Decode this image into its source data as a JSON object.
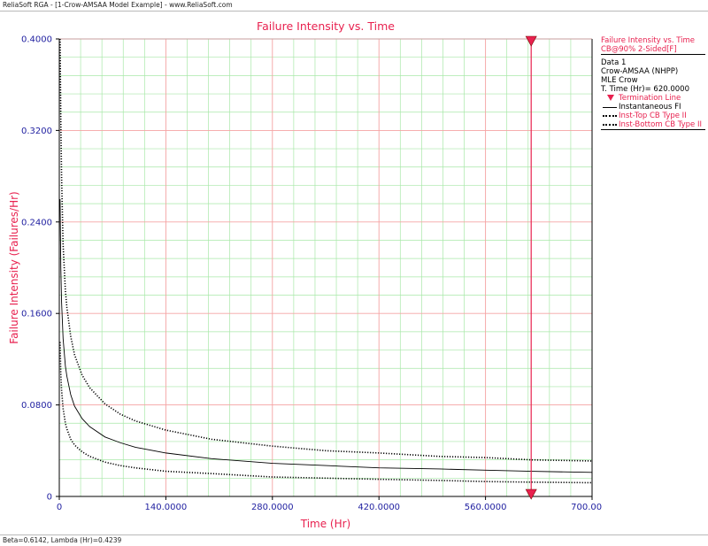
{
  "window": {
    "title": "ReliaSoft RGA - [1-Crow-AMSAA Model Example] - www.ReliaSoft.com"
  },
  "status_bar": {
    "text": "Beta=0.6142, Lambda (Hr)=0.4239"
  },
  "legend": {
    "title": "Failure Intensity vs. Time",
    "subtitle": "CB@90% 2-Sided[F]",
    "info_lines": [
      "Data 1",
      "Crow-AMSAA (NHPP)",
      "MLE Crow",
      "T. Time (Hr)= 620.0000"
    ],
    "entries": [
      {
        "label": "Termination Line",
        "style": "triangle"
      },
      {
        "label": "Instantaneous FI",
        "style": "solid"
      },
      {
        "label": "Inst-Top CB Type II",
        "style": "dotted"
      },
      {
        "label": "Inst-Bottom CB Type II",
        "style": "dotted"
      }
    ]
  },
  "colors": {
    "accent": "#e8214f",
    "axis_text": "#1f1fa0",
    "major_grid": "#f5a3a3",
    "minor_grid": "#a8e8a8",
    "curve": "#000000"
  },
  "chart_data": {
    "type": "line",
    "title": "Failure Intensity vs. Time",
    "xlabel": "Time (Hr)",
    "ylabel": "Failure Intensity (Failures/Hr)",
    "xlim": [
      0,
      700
    ],
    "ylim": [
      0,
      0.4
    ],
    "xticks": [
      0,
      140,
      280,
      420,
      560,
      700
    ],
    "xtick_labels": [
      "0",
      "140.0000",
      "280.0000",
      "420.0000",
      "560.0000",
      "700.0000"
    ],
    "yticks": [
      0,
      0.08,
      0.16,
      0.24,
      0.32,
      0.4
    ],
    "ytick_labels": [
      "0",
      "0.0800",
      "0.1600",
      "0.2400",
      "0.3200",
      "0.4000"
    ],
    "grid": true,
    "legend_position": "right",
    "termination_time": 620,
    "series": [
      {
        "name": "Instantaneous FI",
        "style": "solid",
        "x": [
          1,
          2,
          3,
          5,
          8,
          10,
          15,
          20,
          30,
          40,
          60,
          80,
          100,
          140,
          200,
          280,
          350,
          420,
          500,
          560,
          620,
          700
        ],
        "y": [
          0.26,
          0.2,
          0.17,
          0.138,
          0.114,
          0.105,
          0.089,
          0.079,
          0.068,
          0.061,
          0.052,
          0.047,
          0.043,
          0.038,
          0.033,
          0.029,
          0.027,
          0.025,
          0.024,
          0.023,
          0.022,
          0.021
        ]
      },
      {
        "name": "Inst-Top CB Type II",
        "style": "dotted",
        "x": [
          1,
          2,
          3,
          5,
          8,
          10,
          15,
          20,
          30,
          40,
          60,
          80,
          100,
          140,
          200,
          280,
          350,
          420,
          500,
          560,
          620,
          700
        ],
        "y": [
          0.4,
          0.33,
          0.28,
          0.22,
          0.18,
          0.165,
          0.14,
          0.124,
          0.106,
          0.095,
          0.081,
          0.072,
          0.066,
          0.058,
          0.05,
          0.044,
          0.04,
          0.038,
          0.035,
          0.034,
          0.032,
          0.031
        ]
      },
      {
        "name": "Inst-Bottom CB Type II",
        "style": "dotted",
        "x": [
          1,
          2,
          3,
          5,
          8,
          10,
          15,
          20,
          30,
          40,
          60,
          80,
          100,
          140,
          200,
          280,
          350,
          420,
          500,
          560,
          620,
          700
        ],
        "y": [
          0.135,
          0.108,
          0.093,
          0.077,
          0.064,
          0.059,
          0.05,
          0.045,
          0.039,
          0.035,
          0.03,
          0.027,
          0.025,
          0.022,
          0.02,
          0.017,
          0.016,
          0.015,
          0.014,
          0.013,
          0.0125,
          0.012
        ]
      }
    ]
  }
}
